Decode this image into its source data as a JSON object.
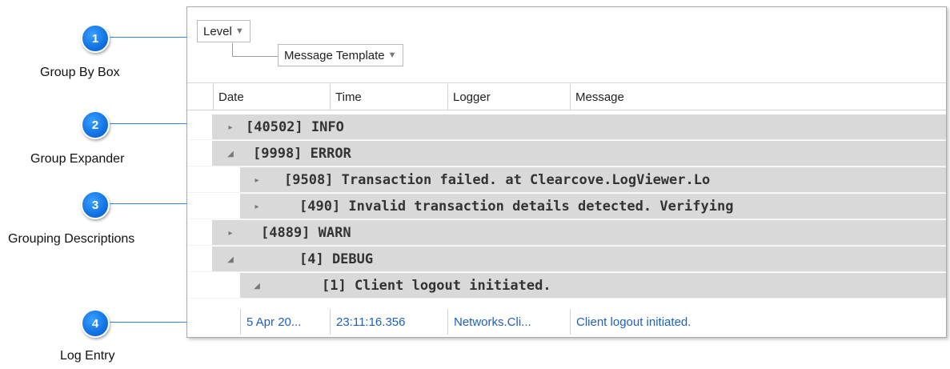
{
  "callouts": [
    {
      "number": "1",
      "label": "Group By Box"
    },
    {
      "number": "2",
      "label": "Group Expander"
    },
    {
      "number": "3",
      "label": "Grouping Descriptions"
    },
    {
      "number": "4",
      "label": "Log Entry"
    }
  ],
  "group_panel": {
    "chips": [
      {
        "label": "Level",
        "arrow": "▼"
      },
      {
        "label": "Message Template",
        "arrow": "▼"
      }
    ]
  },
  "columns": [
    "Date",
    "Time",
    "Logger",
    "Message"
  ],
  "groups": [
    {
      "text": "[40502] INFO",
      "expanded": false,
      "expander": "▸"
    },
    {
      "text": "[9998] ERROR",
      "expanded": true,
      "expander": "◢"
    },
    {
      "text": "[9508] Transaction failed.    at Clearcove.LogViewer.Lo",
      "expanded": false,
      "expander": "▸"
    },
    {
      "text": "[490] Invalid transaction details detected.  Verifying",
      "expanded": false,
      "expander": "▸"
    },
    {
      "text": "[4889] WARN",
      "expanded": false,
      "expander": "▸"
    },
    {
      "text": "[4] DEBUG",
      "expanded": true,
      "expander": "◢"
    },
    {
      "text": "[1] Client logout initiated.",
      "expanded": true,
      "expander": "◢"
    }
  ],
  "entry": {
    "date": "5 Apr 20...",
    "time": "23:11:16.356",
    "logger": "Networks.Cli...",
    "message": "Client logout initiated."
  },
  "colors": {
    "callout_blue": "#1476e6",
    "group_row_bg": "#d9d9d9",
    "entry_text": "#1f5fbf"
  }
}
